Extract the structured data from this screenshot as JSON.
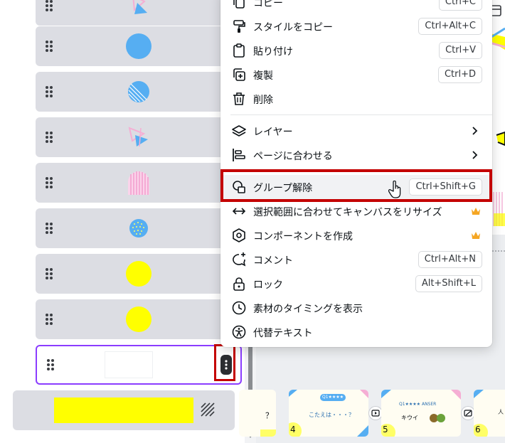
{
  "colors": {
    "accent": "#8b3dff",
    "highlight": "#c40000",
    "layer_row_bg": "#dcdde3",
    "blue": "#56aef2",
    "yellow": "#ffff00",
    "pink": "#f5aed4",
    "crown": "#f5a623"
  },
  "layers": [
    {
      "thumb": "triangle-shapes-icon"
    },
    {
      "thumb": "blue-circle"
    },
    {
      "thumb": "blue-striped-circle"
    },
    {
      "thumb": "triangle-shapes-icon"
    },
    {
      "thumb": "pink-striped-arch"
    },
    {
      "thumb": "blue-dotted-circle"
    },
    {
      "thumb": "yellow-circle"
    },
    {
      "thumb": "yellow-circle"
    },
    {
      "thumb": "white-rectangle",
      "selected": true
    },
    {
      "thumb": "yellow-background-rectangle",
      "extra_icon": "pattern-icon"
    }
  ],
  "context_menu": {
    "items": [
      {
        "label": "コピー",
        "shortcut": "Ctrl+C",
        "icon": "copy-icon"
      },
      {
        "label": "スタイルをコピー",
        "shortcut": "Ctrl+Alt+C",
        "icon": "paint-roller-icon"
      },
      {
        "label": "貼り付け",
        "shortcut": "Ctrl+V",
        "icon": "clipboard-icon"
      },
      {
        "label": "複製",
        "shortcut": "Ctrl+D",
        "icon": "duplicate-icon"
      },
      {
        "label": "削除",
        "icon": "trash-icon"
      },
      {
        "label": "レイヤー",
        "icon": "layers-icon",
        "submenu": true
      },
      {
        "label": "ページに合わせる",
        "icon": "align-icon",
        "submenu": true
      },
      {
        "label": "グループ解除",
        "shortcut": "Ctrl+Shift+G",
        "icon": "ungroup-icon",
        "highlighted": true
      },
      {
        "label": "選択範囲に合わせてキャンバスをリサイズ",
        "icon": "resize-arrows-icon",
        "premium": true
      },
      {
        "label": "コンポーネントを作成",
        "icon": "component-icon",
        "premium": true
      },
      {
        "label": "コメント",
        "shortcut": "Ctrl+Alt+N",
        "icon": "comment-add-icon"
      },
      {
        "label": "ロック",
        "shortcut": "Alt+Shift+L",
        "icon": "lock-icon"
      },
      {
        "label": "素材のタイミングを表示",
        "icon": "clock-icon"
      },
      {
        "label": "代替テキスト",
        "icon": "accessibility-icon"
      }
    ]
  },
  "filmstrip": {
    "slides": [
      {
        "number": "",
        "text": "？"
      },
      {
        "number": "4",
        "badge": "Q1★★★★",
        "text": "こたえは・・・？"
      },
      {
        "number": "5",
        "badge": "Q1★★★★ ANSER",
        "text": "キウイ"
      },
      {
        "number": "6",
        "text": "人"
      }
    ]
  }
}
